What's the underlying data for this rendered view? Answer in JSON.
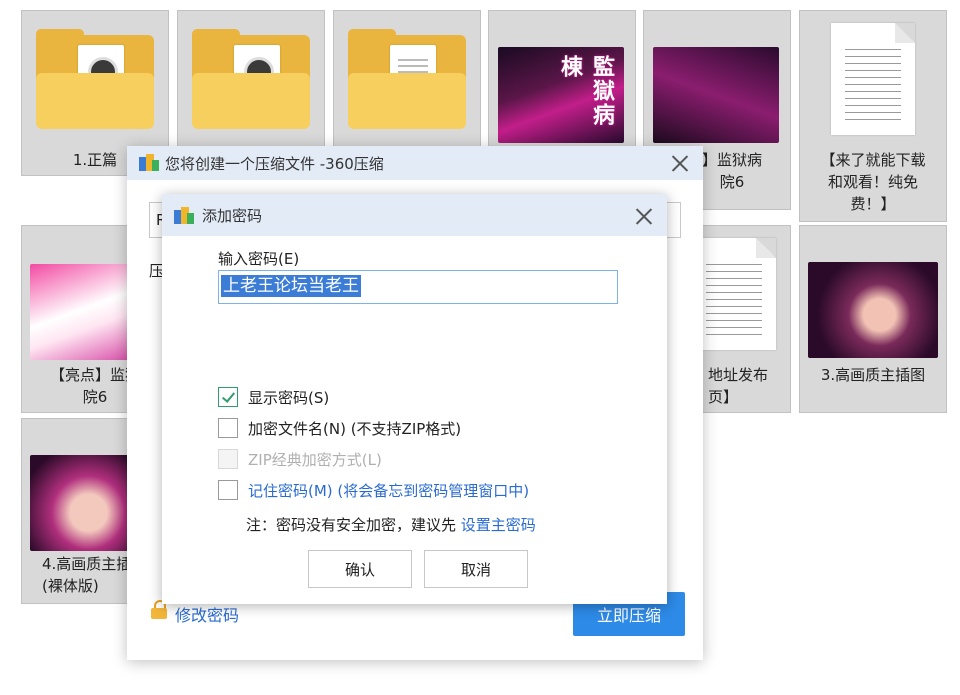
{
  "files": [
    {
      "caption": "1.正篇",
      "kind": "folder-image"
    },
    {
      "caption": "",
      "kind": "folder-image"
    },
    {
      "caption": "",
      "kind": "folder-doc"
    },
    {
      "caption": "",
      "kind": "poster",
      "poster_text": "監獄病棟"
    },
    {
      "caption": "】监狱病\n院6",
      "kind": "poster"
    },
    {
      "caption": "【来了就能下载\n和观看！纯免\n费！】",
      "kind": "document"
    },
    {
      "caption": "【亮点】监狱\n院6",
      "kind": "poster"
    },
    {
      "caption": "地址发布\n页】",
      "kind": "document"
    },
    {
      "caption": "3.高画质主插图",
      "kind": "image"
    },
    {
      "caption": "4.高画质主插\n(裸体版)",
      "kind": "image"
    }
  ],
  "outer_dialog": {
    "title": "您将创建一个压缩文件 -360压缩",
    "path_value": "R",
    "row_label": "压",
    "change_password": "修改密码",
    "compress_button": "立即压缩"
  },
  "password_dialog": {
    "title": "添加密码",
    "input_label": "输入密码(E)",
    "password_value": "上老王论坛当老王",
    "show_password": {
      "label": "显示密码(S)",
      "checked": true
    },
    "encrypt_filename": {
      "label": "加密文件名(N) (不支持ZIP格式)",
      "checked": false
    },
    "zip_classic": {
      "label": "ZIP经典加密方式(L)",
      "checked": false,
      "disabled": true
    },
    "remember_password": {
      "label": "记住密码(M) (将会备忘到密码管理窗口中)",
      "checked": false
    },
    "note_prefix": "注：密码没有安全加密，建议先",
    "note_link": "设置主密码",
    "confirm": "确认",
    "cancel": "取消"
  }
}
